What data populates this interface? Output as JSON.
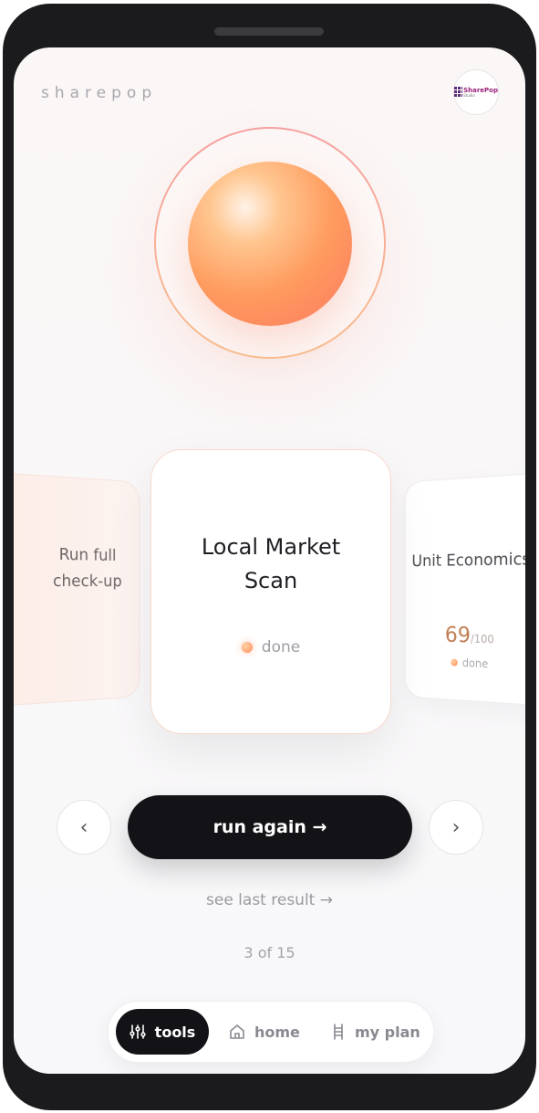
{
  "app": {
    "brand": "sharepop",
    "logo_line1": "SharePop",
    "logo_line2": "Studio"
  },
  "carousel": {
    "left_card": {
      "title": "Run full check-up"
    },
    "center_card": {
      "title": "Local Market Scan",
      "status": "done"
    },
    "right_card": {
      "title": "Unit Economics",
      "score": "69",
      "score_max": "/100",
      "status": "done"
    }
  },
  "controls": {
    "prev_icon": "‹",
    "next_icon": "›",
    "run_label": "run again →",
    "see_last_label": "see last result →",
    "counter": "3 of 15"
  },
  "bottom_nav": {
    "items": [
      {
        "label": "tools",
        "icon": "sliders-icon",
        "active": true
      },
      {
        "label": "home",
        "icon": "home-icon",
        "active": false
      },
      {
        "label": "my plan",
        "icon": "ladder-icon",
        "active": false
      }
    ]
  },
  "colors": {
    "accent": "#ff8a5a",
    "dark": "#131317",
    "score": "#c08055"
  }
}
